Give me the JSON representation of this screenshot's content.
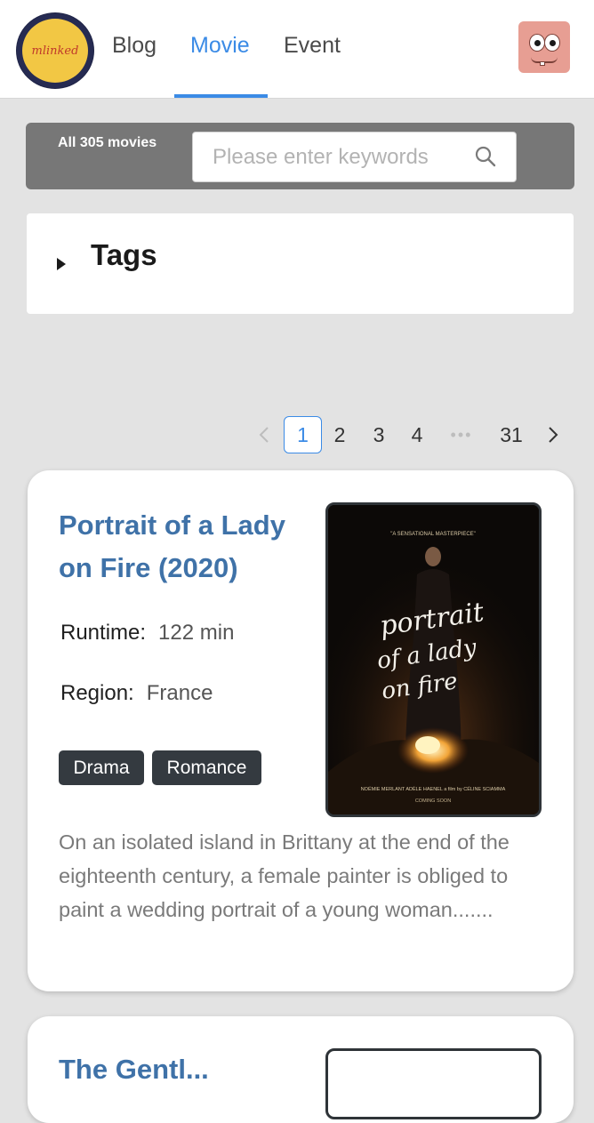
{
  "header": {
    "logo_text": "mlinked",
    "nav": [
      "Blog",
      "Movie",
      "Event"
    ],
    "active_nav": "Movie"
  },
  "search": {
    "count_label": "All 305 movies",
    "placeholder": "Please enter keywords"
  },
  "tags": {
    "title": "Tags"
  },
  "pagination": {
    "pages": [
      "1",
      "2",
      "3",
      "4",
      "•••",
      "31"
    ],
    "current": "1",
    "prev_icon": "chevron-left-icon",
    "next_icon": "chevron-right-icon"
  },
  "movies": [
    {
      "title": "Portrait of a Lady on Fire (2020)",
      "runtime_label": "Runtime:",
      "runtime_value": "122 min",
      "region_label": "Region:",
      "region_value": "France",
      "tags": [
        "Drama",
        "Romance"
      ],
      "synopsis": "On an isolated island in Brittany at the end of the eighteenth century, a female painter is obliged to paint a wedding portrait of a young woman.......",
      "poster": {
        "top_line": "\"A SENSATIONAL MASTERPIECE\"",
        "script_lines": [
          "portrait",
          "of a lady",
          "on fire"
        ],
        "credits": "NOÉMIE MERLANT   ADÈLE HAENEL   a film by CÉLINE SCIAMMA",
        "coming_soon": "COMING SOON"
      }
    },
    {
      "title": "The Gentl..."
    }
  ],
  "colors": {
    "accent": "#3b8be6",
    "title_link": "#3f72a8",
    "tag_bg": "#343a40",
    "page_bg": "#e3e3e3"
  }
}
